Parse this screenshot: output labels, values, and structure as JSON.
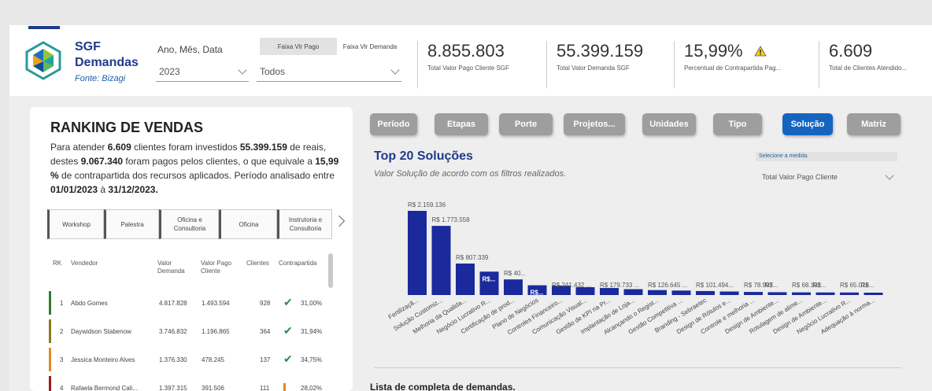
{
  "app": {
    "title_line1": "SGF",
    "title_line2": "Demandas",
    "subtitle": "Fonte: Bizagi"
  },
  "filters": {
    "date_label": "Ano, Mês, Data",
    "date_value": "2023",
    "faixa_pago_label": "Faixa Vlr Pago",
    "faixa_demanda_label": "Faixa Vlr Demanda",
    "faixa_value": "Todos"
  },
  "kpis": [
    {
      "value": "8.855.803",
      "caption": "Total Valor Pago Cliente SGF"
    },
    {
      "value": "55.399.159",
      "caption": "Total Valor Demanda SGF"
    },
    {
      "value": "15,99%",
      "caption": "Percentual de Contrapartida Pag..."
    },
    {
      "value": "6.609",
      "caption": "Total de Clientes Atendido..."
    }
  ],
  "ranking": {
    "title": "RANKING DE VENDAS",
    "desc": {
      "p1": "Para atender ",
      "clientes": "6.609",
      "p2": " clientes foram investidos ",
      "investido": "55.399.159",
      "p3": " de reais, destes ",
      "pago": "9.067.340",
      "p4": " foram pagos pelos clientes, o que equivale a ",
      "pct": "15,99 %",
      "p5": " de contrapartida dos recursos aplicados. Período analisado entre ",
      "start": "01/01/2023",
      "p6": " à ",
      "end": "31/12/2023."
    },
    "categories": [
      "Workshop",
      "Palestra",
      "Oficina e Consultoria",
      "Oficina",
      "Instrutoria e Consultoria"
    ],
    "columns": {
      "rk": "RK",
      "vendedor": "Vendedor",
      "valor_demanda": "Valor Demanda",
      "valor_pago": "Valor Pago Cliente",
      "clientes": "Clientes",
      "contrapartida": "Contrapartida"
    },
    "rows": [
      {
        "rk": "1",
        "vendedor": "Abdo Gomes",
        "demanda": "4.817.828",
        "pago": "1.493.594",
        "clientes": "928",
        "status": "ok",
        "pct": "31,00%",
        "color": "#2e7d32"
      },
      {
        "rk": "2",
        "vendedor": "Daywidson Stabenow",
        "demanda": "3.746.832",
        "pago": "1.196.865",
        "clientes": "364",
        "status": "ok",
        "pct": "31,94%",
        "color": "#8a7a1e"
      },
      {
        "rk": "3",
        "vendedor": "Jessica Monteiro Alves",
        "demanda": "1.376.330",
        "pago": "478.245",
        "clientes": "137",
        "status": "ok",
        "pct": "34,75%",
        "color": "#e08a1e"
      },
      {
        "rk": "4",
        "vendedor": "Rafaela Bermond Cali...",
        "demanda": "1.397.315",
        "pago": "391.506",
        "clientes": "111",
        "status": "warn",
        "pct": "28,02%",
        "color": "#a01818"
      }
    ]
  },
  "nav_buttons": [
    "Período",
    "Etapas",
    "Porte",
    "Projetos...",
    "Unidades",
    "Tipo",
    "Solução",
    "Matriz"
  ],
  "nav_active": "Solução",
  "solucoes": {
    "title": "Top 20 Soluções",
    "subtitle": "Valor Solução de acordo com os filtros realizados.",
    "measure_label": "Selecione a medida.",
    "measure_value": "Total Valor Pago Cliente"
  },
  "chart_data": {
    "type": "bar",
    "title": "Top 20 Soluções",
    "categories": [
      "Fertilizaçã...",
      "Solução Customiz...",
      "Melhoria da Qualida...",
      "Negócio Lucrativo R...",
      "Certificação de prod...",
      "Plano de Negócios",
      "Controles Financeiro...",
      "Comunicação Visual...",
      "Gestão de KPI na Pr...",
      "Implantação de Loja...",
      "Alcançando o Regist...",
      "Gestão Competitiva ...",
      "Branding - Sebraetec",
      "Design de Rótulos e...",
      "Controle e melhoria ...",
      "Design de Ambiente...",
      "Rotulagem de alime...",
      "Design de Ambiente...",
      "Negócio Lucrativo R...",
      "Adequação à norma..."
    ],
    "values": [
      2159136,
      1773558,
      807339,
      600000,
      400000,
      250000,
      241432,
      200000,
      179733,
      150000,
      126645,
      115000,
      101494,
      90000,
      78907,
      72000,
      68102,
      66000,
      65016,
      60000
    ],
    "labels": [
      "R$ 2.159.136",
      "R$ 1.773.558",
      "R$ 807.339",
      "R$...",
      "R$ 40...",
      "R$...",
      "R$ 241.432 ...",
      "",
      "R$ 179.733 ...",
      "",
      "R$ 126.645 ...",
      "",
      "R$ 101.494...",
      "",
      "R$ 78.907",
      "R$...",
      "R$ 68.102",
      "R$...",
      "R$ 65.016",
      "R$..."
    ],
    "ylim": [
      0,
      2300000
    ],
    "bar_color": "#1a2a9c"
  },
  "lista_title": "Lista de completa de demandas."
}
